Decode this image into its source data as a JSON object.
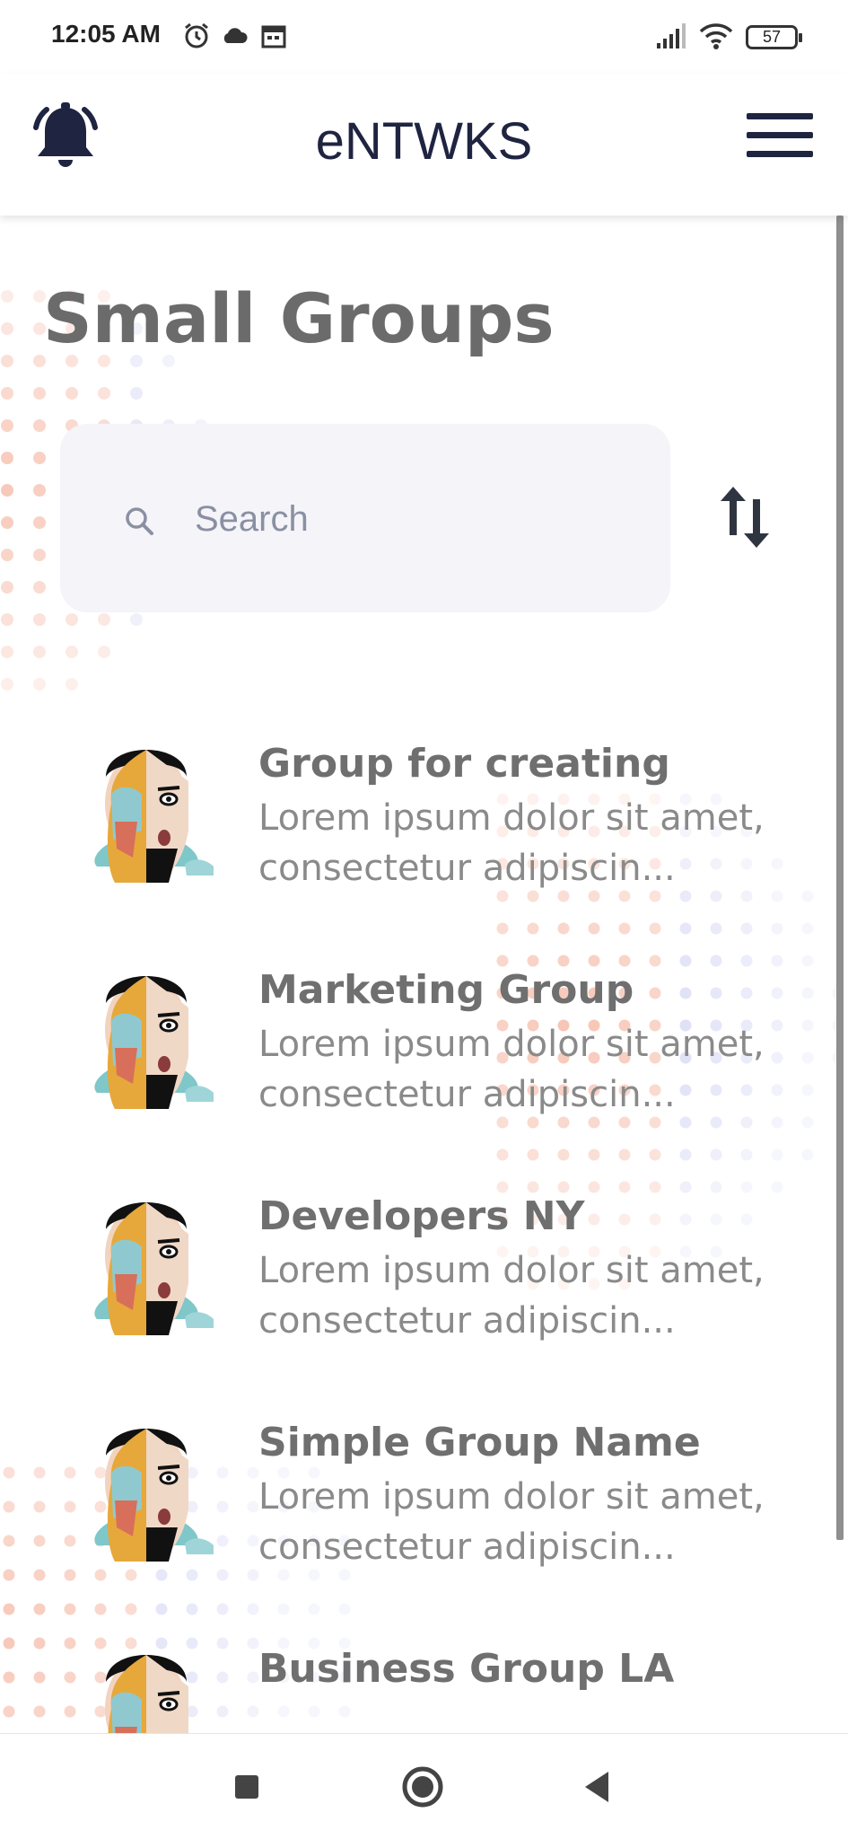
{
  "status_bar": {
    "time": "12:05 AM",
    "battery": "57"
  },
  "header": {
    "title": "eNTWKS"
  },
  "page": {
    "title": "Small Groups"
  },
  "search": {
    "placeholder": "Search"
  },
  "groups": [
    {
      "name": "Group for creating",
      "desc_line1": "Lorem ipsum dolor sit amet,",
      "desc_line2": "consectetur adipiscin..."
    },
    {
      "name": "Marketing Group",
      "desc_line1": "Lorem ipsum dolor sit amet,",
      "desc_line2": "consectetur adipiscin..."
    },
    {
      "name": "Developers NY",
      "desc_line1": "Lorem ipsum dolor sit amet,",
      "desc_line2": "consectetur adipiscin..."
    },
    {
      "name": "Simple Group Name",
      "desc_line1": "Lorem ipsum dolor sit amet,",
      "desc_line2": "consectetur adipiscin..."
    },
    {
      "name": "Business Group LA",
      "desc_line1": "",
      "desc_line2": ""
    }
  ],
  "icons": {
    "notifications": "bell-icon",
    "menu": "hamburger-menu-icon",
    "search": "search-icon",
    "sort": "sort-arrows-icon",
    "nav_recents": "square-icon",
    "nav_home": "circle-icon",
    "nav_back": "triangle-back-icon"
  },
  "colors": {
    "brand_dark": "#1f2441",
    "title_gray": "#6b6b6b",
    "search_bg": "#f4f4f9",
    "dot_orange": "#f5b9a6",
    "dot_purple": "#c3c6ee"
  }
}
